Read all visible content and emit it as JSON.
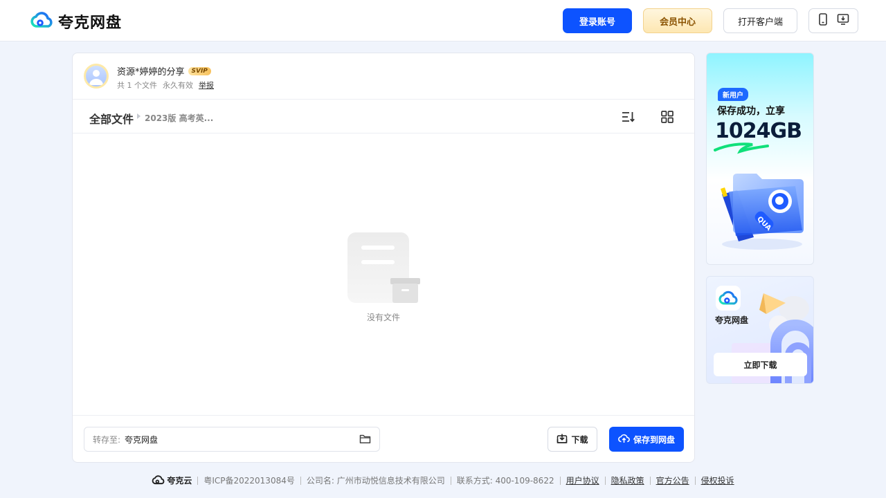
{
  "header": {
    "logo_text": "夸克网盘",
    "login_label": "登录账号",
    "vip_label": "会员中心",
    "client_label": "打开客户端"
  },
  "share": {
    "title": "资源*婷婷的分享",
    "badge": "SVIP",
    "file_count": "共 1 个文件",
    "validity": "永久有效",
    "report_label": "举报"
  },
  "breadcrumb": {
    "root": "全部文件",
    "current": "2023版 高考英..."
  },
  "empty": {
    "message": "没有文件"
  },
  "bottom": {
    "save_to_label": "转存至:",
    "save_to_value": "夸克网盘",
    "download_label": "下载",
    "save_label": "保存到网盘"
  },
  "ad1": {
    "tag": "新用户",
    "line1": "保存成功，立享",
    "big": "1024GB",
    "folder_letters": "QUA"
  },
  "ad2": {
    "name": "夸克网盘",
    "button": "立即下载"
  },
  "footer": {
    "brand": "夸克云",
    "icp": "粤ICP备2022013084号",
    "company": "公司名: 广州市动悦信息技术有限公司",
    "contact": "联系方式: 400-109-8622",
    "links": [
      "用户协议",
      "隐私政策",
      "官方公告",
      "侵权投诉"
    ]
  },
  "colors": {
    "primary": "#0d53ff",
    "vip_text": "#8a5200",
    "page_bg": "#f0f4fc"
  },
  "icons": [
    "quark-cloud-logo-icon",
    "phone-icon",
    "monitor-download-icon",
    "sort-icon",
    "grid-view-icon",
    "folder-icon",
    "download-icon",
    "cloud-upload-icon",
    "user-avatar-icon"
  ]
}
